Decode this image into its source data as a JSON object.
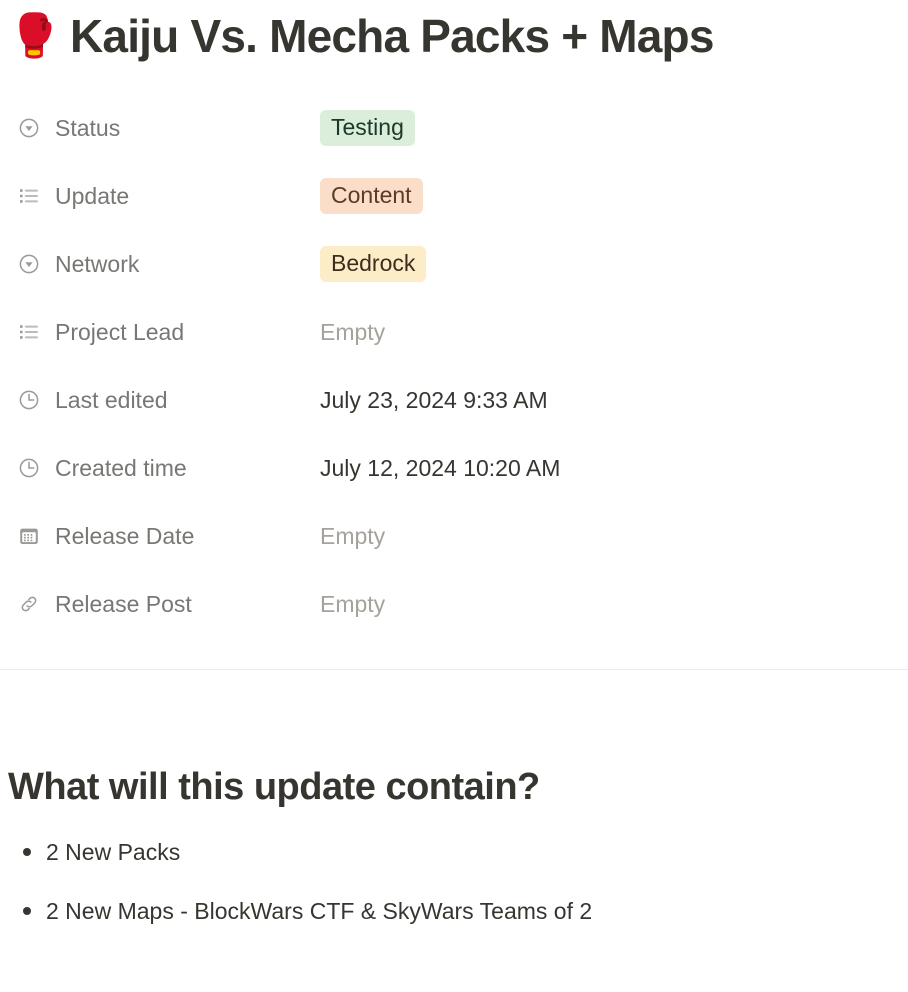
{
  "page": {
    "emoji": "🥊",
    "emoji_name": "boxing-glove",
    "title": "Kaiju Vs. Mecha Packs + Maps"
  },
  "properties": [
    {
      "icon": "select-icon",
      "label": "Status",
      "value": "Testing",
      "type": "tag",
      "tag_color": "green",
      "bg": "#dbeddb",
      "fg": "#1c3829"
    },
    {
      "icon": "multi-select-icon",
      "label": "Update",
      "value": "Content",
      "type": "tag",
      "tag_color": "orange",
      "bg": "#fadec9",
      "fg": "#5c3b23"
    },
    {
      "icon": "select-icon",
      "label": "Network",
      "value": "Bedrock",
      "type": "tag",
      "tag_color": "yellow",
      "bg": "#fdecc8",
      "fg": "#402c1b"
    },
    {
      "icon": "multi-select-icon",
      "label": "Project Lead",
      "value": "Empty",
      "type": "empty"
    },
    {
      "icon": "clock-icon",
      "label": "Last edited",
      "value": "July 23, 2024 9:33 AM",
      "type": "text"
    },
    {
      "icon": "clock-icon",
      "label": "Created time",
      "value": "July 12, 2024 10:20 AM",
      "type": "text"
    },
    {
      "icon": "calendar-icon",
      "label": "Release Date",
      "value": "Empty",
      "type": "empty"
    },
    {
      "icon": "link-icon",
      "label": "Release Post",
      "value": "Empty",
      "type": "empty"
    }
  ],
  "content": {
    "heading": "What will this update contain?",
    "bullets": [
      "2 New Packs",
      "2 New Maps - BlockWars CTF & SkyWars Teams of 2"
    ]
  },
  "colors": {
    "text": "#37352f",
    "label": "#787774",
    "placeholder": "#a5a29c",
    "icon": "#9b9a97",
    "divider": "#ebebea",
    "background": "#ffffff"
  }
}
